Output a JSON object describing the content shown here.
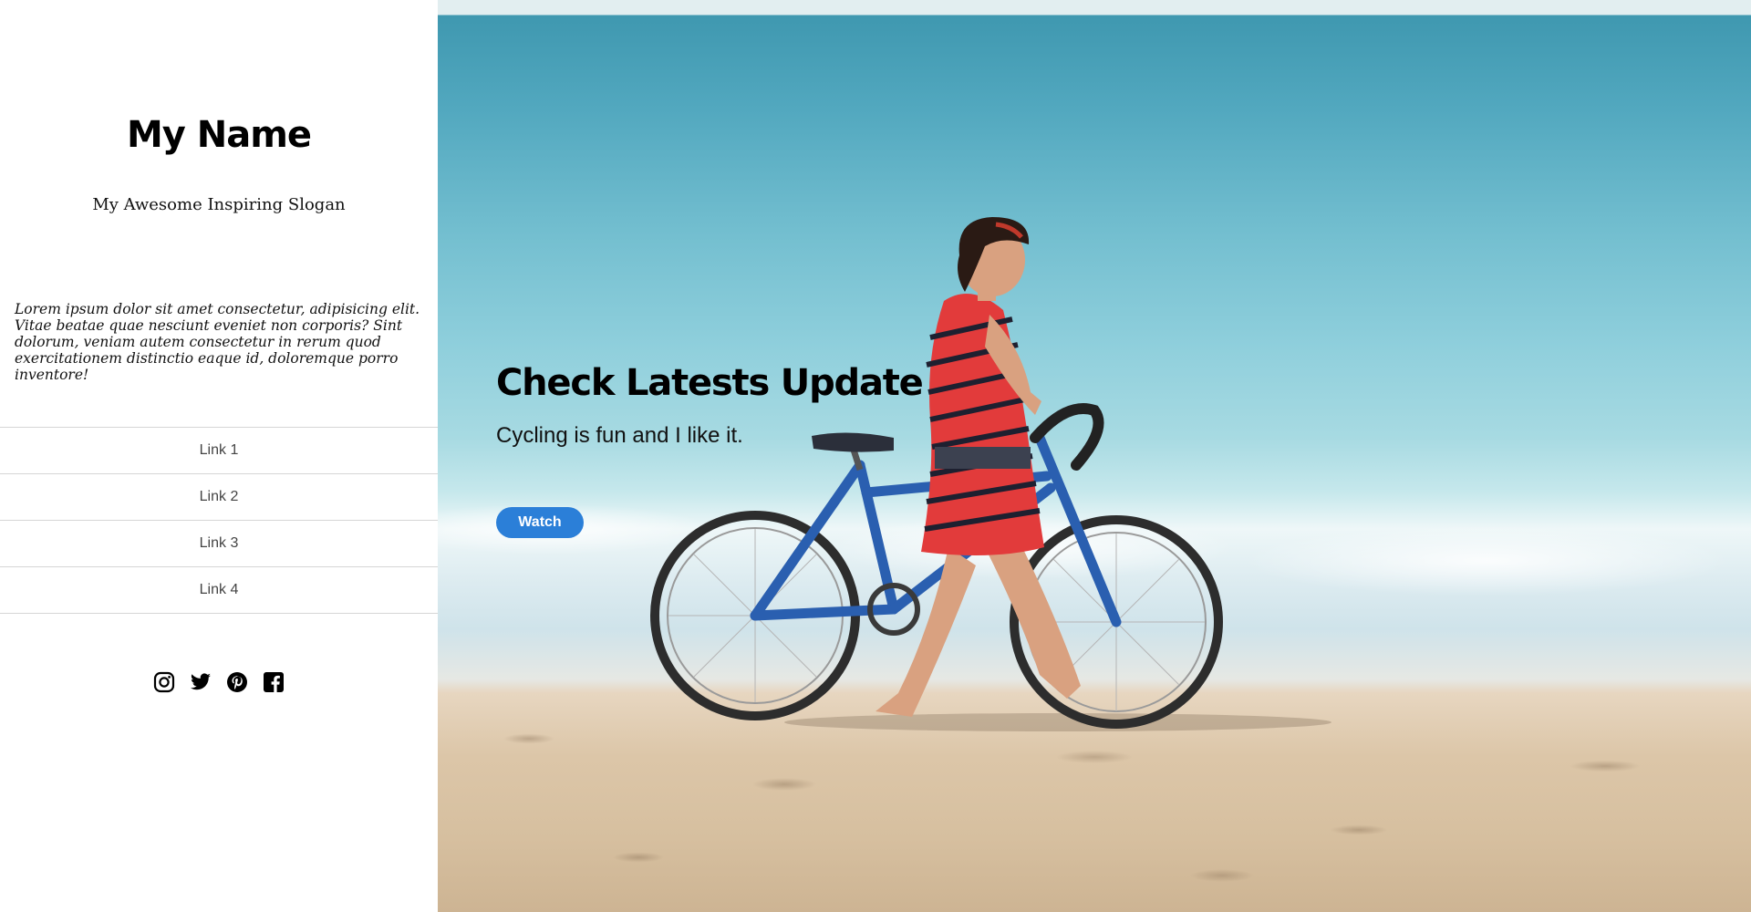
{
  "sidebar": {
    "site_name": "My Name",
    "slogan": "My Awesome Inspiring Slogan",
    "intro": "Lorem ipsum dolor sit amet consectetur, adipisicing elit. Vitae beatae quae nesciunt eveniet non corporis? Sint dolorum, veniam autem consectetur in rerum quod exercitationem distinctio eaque id, doloremque porro inventore!",
    "nav": [
      {
        "label": "Link 1"
      },
      {
        "label": "Link 2"
      },
      {
        "label": "Link 3"
      },
      {
        "label": "Link 4"
      }
    ],
    "social": [
      {
        "icon": "instagram-icon"
      },
      {
        "icon": "twitter-icon"
      },
      {
        "icon": "pinterest-icon"
      },
      {
        "icon": "facebook-icon"
      }
    ]
  },
  "hero": {
    "headline": "Check Latests Update",
    "subline": "Cycling is fun and I like it.",
    "button_label": "Watch",
    "button_color": "#2b7fd8",
    "background_image": "woman walking a blue bicycle along the beach shoreline"
  }
}
